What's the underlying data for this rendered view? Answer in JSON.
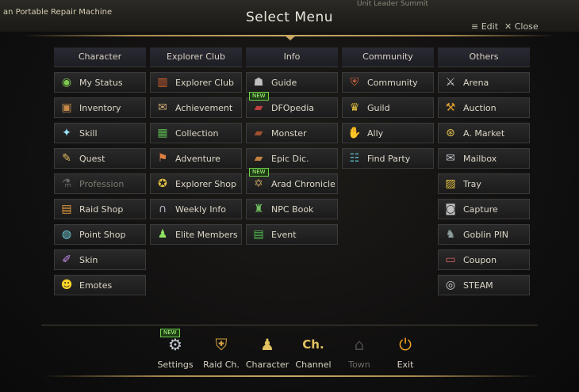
{
  "background": {
    "left_text": "an Portable Repair Machine",
    "top_right_text": "Unit Leader Summit"
  },
  "header": {
    "title": "Select Menu",
    "edit_label": "≡ Edit",
    "close_label": "✕ Close"
  },
  "columns": [
    {
      "title": "Character",
      "items": [
        {
          "label": "My Status",
          "icon": "status-icon",
          "glyph": "◉",
          "color": "#7ec850"
        },
        {
          "label": "Inventory",
          "icon": "inventory-icon",
          "glyph": "▣",
          "color": "#c68a4a"
        },
        {
          "label": "Skill",
          "icon": "skill-icon",
          "glyph": "✦",
          "color": "#9be4ff"
        },
        {
          "label": "Quest",
          "icon": "quest-scroll-icon",
          "glyph": "✎",
          "color": "#e2b860"
        },
        {
          "label": "Profession",
          "icon": "profession-icon",
          "glyph": "⚗",
          "color": "#a0a0a0",
          "disabled": true
        },
        {
          "label": "Raid Shop",
          "icon": "raid-shop-icon",
          "glyph": "▤",
          "color": "#e89a3a"
        },
        {
          "label": "Point Shop",
          "icon": "point-shop-icon",
          "glyph": "◍",
          "color": "#6fd0e0"
        },
        {
          "label": "Skin",
          "icon": "skin-brush-icon",
          "glyph": "✐",
          "color": "#c88ef0"
        },
        {
          "label": "Emotes",
          "icon": "emote-smiley-icon",
          "glyph": "☻",
          "color": "#ffd42a"
        }
      ]
    },
    {
      "title": "Explorer Club",
      "items": [
        {
          "label": "Explorer Club",
          "icon": "explorer-club-icon",
          "glyph": "▥",
          "color": "#d96030"
        },
        {
          "label": "Achievement",
          "icon": "achievement-scroll-icon",
          "glyph": "✉",
          "color": "#d4b078"
        },
        {
          "label": "Collection",
          "icon": "collection-icon",
          "glyph": "▦",
          "color": "#5ab050"
        },
        {
          "label": "Adventure",
          "icon": "adventure-icon",
          "glyph": "⚑",
          "color": "#e08040"
        },
        {
          "label": "Explorer Shop",
          "icon": "explorer-shop-icon",
          "glyph": "✪",
          "color": "#e0c040"
        },
        {
          "label": "Weekly Info",
          "icon": "weekly-info-icon",
          "glyph": "∩",
          "color": "#b0b0c0"
        },
        {
          "label": "Elite Members",
          "icon": "elite-members-icon",
          "glyph": "♟",
          "color": "#90e060"
        }
      ]
    },
    {
      "title": "Info",
      "items": [
        {
          "label": "Guide",
          "icon": "guide-icon",
          "glyph": "☗",
          "color": "#c0c0c0"
        },
        {
          "label": "DFOpedia",
          "icon": "dfopedia-book-icon",
          "glyph": "▰",
          "color": "#c04040",
          "new": true
        },
        {
          "label": "Monster",
          "icon": "monster-book-icon",
          "glyph": "▰",
          "color": "#a05030"
        },
        {
          "label": "Epic Dic.",
          "icon": "epic-dictionary-icon",
          "glyph": "▰",
          "color": "#c08040"
        },
        {
          "label": "Arad Chronicle",
          "icon": "arad-chronicle-icon",
          "glyph": "✡",
          "color": "#c0a060",
          "new": true
        },
        {
          "label": "NPC Book",
          "icon": "npc-book-icon",
          "glyph": "♜",
          "color": "#70c060"
        },
        {
          "label": "Event",
          "icon": "event-icon",
          "glyph": "▤",
          "color": "#50c050"
        }
      ]
    },
    {
      "title": "Community",
      "items": [
        {
          "label": "Community",
          "icon": "community-shield-icon",
          "glyph": "⛨",
          "color": "#d06040"
        },
        {
          "label": "Guild",
          "icon": "guild-emblem-icon",
          "glyph": "♛",
          "color": "#e0c040"
        },
        {
          "label": "Ally",
          "icon": "ally-handshake-icon",
          "glyph": "✋",
          "color": "#e0a070"
        },
        {
          "label": "Find Party",
          "icon": "find-party-icon",
          "glyph": "☷",
          "color": "#60c0d0"
        }
      ]
    },
    {
      "title": "Others",
      "items": [
        {
          "label": "Arena",
          "icon": "arena-swords-icon",
          "glyph": "⚔",
          "color": "#d0d0d0"
        },
        {
          "label": "Auction",
          "icon": "auction-hammer-icon",
          "glyph": "⚒",
          "color": "#e0a030"
        },
        {
          "label": "A. Market",
          "icon": "market-coin-icon",
          "glyph": "⊛",
          "color": "#e0c050"
        },
        {
          "label": "Mailbox",
          "icon": "mailbox-envelope-icon",
          "glyph": "✉",
          "color": "#c0c8d0"
        },
        {
          "label": "Tray",
          "icon": "tray-icon",
          "glyph": "▨",
          "color": "#e0c040"
        },
        {
          "label": "Capture",
          "icon": "capture-camera-icon",
          "glyph": "◙",
          "color": "#c0c0c0"
        },
        {
          "label": "Goblin PIN",
          "icon": "goblin-pin-icon",
          "glyph": "♞",
          "color": "#90a0a0"
        },
        {
          "label": "Coupon",
          "icon": "coupon-icon",
          "glyph": "▭",
          "color": "#e06060"
        },
        {
          "label": "STEAM",
          "icon": "steam-logo-icon",
          "glyph": "◎",
          "color": "#d0d0d0"
        }
      ]
    }
  ],
  "bottom_bar": [
    {
      "label": "Settings",
      "icon": "settings-gear-icon",
      "glyph": "⚙",
      "color": "#c0c8d0",
      "new": true
    },
    {
      "label": "Raid Ch.",
      "icon": "raid-channel-icon",
      "glyph": "⛨",
      "color": "#d0a040"
    },
    {
      "label": "Character",
      "icon": "character-icon",
      "glyph": "♟",
      "color": "#e0c060"
    },
    {
      "label": "Channel",
      "icon": "channel-icon",
      "glyph": "Ch.",
      "color": "#e0c060"
    },
    {
      "label": "Town",
      "icon": "town-house-icon",
      "glyph": "⌂",
      "color": "#a0a0a0",
      "disabled": true
    },
    {
      "label": "Exit",
      "icon": "exit-power-icon",
      "glyph": "⏻",
      "color": "#f0a020"
    }
  ],
  "new_badge_text": "NEW"
}
